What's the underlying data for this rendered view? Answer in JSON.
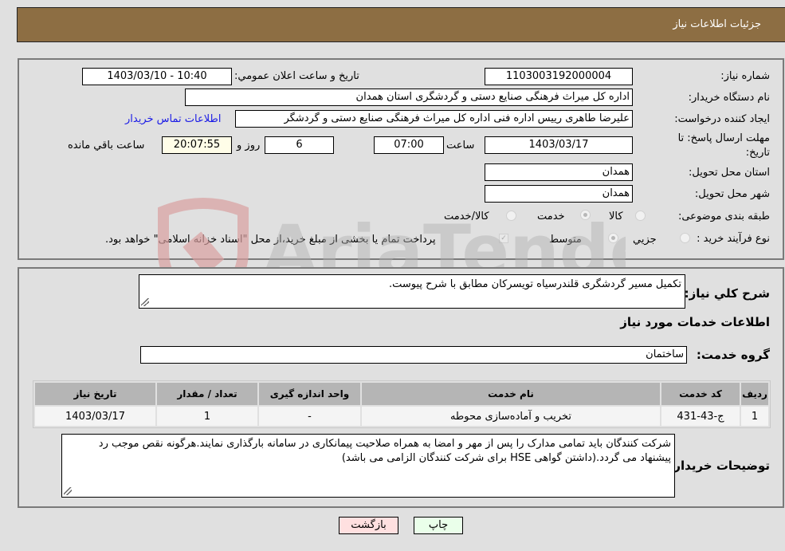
{
  "header": {
    "title": "جزئیات اطلاعات نیاز"
  },
  "form": {
    "need_number": {
      "label": "شماره نیاز:",
      "value": "1103003192000004"
    },
    "announce_datetime": {
      "label": "تاریخ و ساعت اعلان عمومي:",
      "value": "1403/03/10 - 10:40"
    },
    "buyer_org": {
      "label": "نام دستگاه خریدار:",
      "value": "اداره کل میراث فرهنگی  صنایع دستی و گردشگری استان همدان"
    },
    "requester": {
      "label": "ایجاد کننده درخواست:",
      "value": "علیرضا طاهری رییس اداره فنی اداره کل میراث فرهنگی  صنایع دستی و گردشگر",
      "contact_link": "اطلاعات تماس خریدار"
    },
    "deadline": {
      "label_line1": "مهلت ارسال پاسخ: تا",
      "label_line2": "تاریخ:",
      "date": "1403/03/17",
      "time_label": "ساعت",
      "time": "07:00",
      "days": "6",
      "days_label": "روز و",
      "remaining": "20:07:55",
      "remaining_label": "ساعت باقي مانده"
    },
    "province": {
      "label": "استان محل تحویل:",
      "value": "همدان"
    },
    "city": {
      "label": "شهر محل تحویل:",
      "value": "همدان"
    },
    "category": {
      "label": "طبقه بندی موضوعی:",
      "options": [
        {
          "label": "کالا",
          "selected": false
        },
        {
          "label": "خدمت",
          "selected": true
        },
        {
          "label": "کالا/خدمت",
          "selected": false
        }
      ]
    },
    "purchase_type": {
      "label": "نوع فرآیند خرید :",
      "options": [
        {
          "label": "جزيي",
          "selected": false
        },
        {
          "label": "متوسط",
          "selected": true
        }
      ],
      "treasury_checkbox": {
        "checked": true,
        "label": "پرداخت تمام یا بخشی از مبلغ خرید،از محل \"اسناد خزانه اسلامی\" خواهد بود."
      }
    }
  },
  "details": {
    "summary_label": "شرح كلي نياز:",
    "summary_value": "تکمیل مسیر گردشگری قلندرسیاه تویسرکان مطابق با شرح پیوست.",
    "services_heading": "اطلاعات خدمات مورد نیاز",
    "service_group_label": "گروه خدمت:",
    "service_group_value": "ساختمان",
    "table": {
      "headers": [
        "ردیف",
        "کد خدمت",
        "نام خدمت",
        "واحد اندازه گیری",
        "تعداد / مقدار",
        "تاریخ نیاز"
      ],
      "rows": [
        [
          "1",
          "ج-43-431",
          "تخریب و آماده‌سازی محوطه",
          "-",
          "1",
          "1403/03/17"
        ]
      ]
    },
    "buyer_notes_label": "توضیحات خریدار:",
    "buyer_notes_value": "شرکت کنندگان باید تمامی مدارک را پس از مهر و امضا به همراه صلاحیت پیمانکاری در سامانه بارگذاری نمایند.هرگونه نقص موجب رد پیشنهاد می گردد.(داشتن گواهی HSE برای شرکت کنندگان الزامی می باشد)"
  },
  "buttons": {
    "print": "چاپ",
    "back": "بازگشت"
  },
  "watermark": {
    "text": "AriaTender.neT"
  },
  "colors": {
    "header_bg": "#8d6e43",
    "print_bg": "#eaffea",
    "back_bg": "#ffe0e0",
    "link": "#1a1ae6",
    "remaining_bg": "#fffde8"
  }
}
